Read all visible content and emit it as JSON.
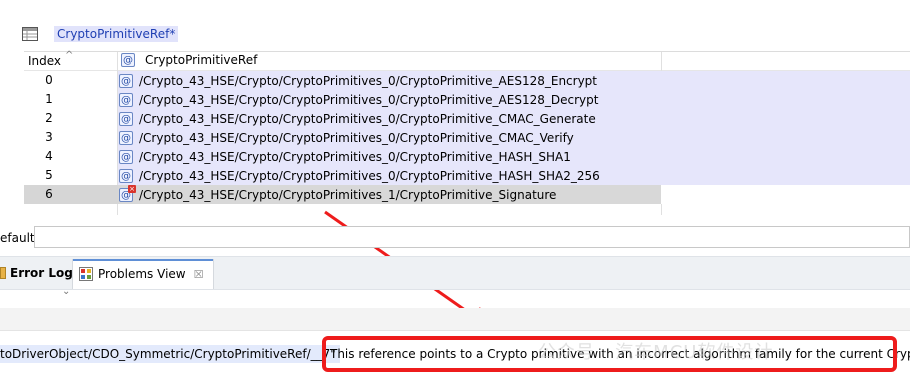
{
  "editor": {
    "title": "CryptoPrimitiveRef*",
    "table_icon": "table-icon"
  },
  "table": {
    "headers": {
      "index": "Index",
      "ref": "CryptoPrimitiveRef"
    },
    "ref_icon": "at-reference-icon",
    "rows": [
      {
        "index": "0",
        "path": "/Crypto_43_HSE/Crypto/CryptoPrimitives_0/CryptoPrimitive_AES128_Encrypt",
        "error": false
      },
      {
        "index": "1",
        "path": "/Crypto_43_HSE/Crypto/CryptoPrimitives_0/CryptoPrimitive_AES128_Decrypt",
        "error": false
      },
      {
        "index": "2",
        "path": "/Crypto_43_HSE/Crypto/CryptoPrimitives_0/CryptoPrimitive_CMAC_Generate",
        "error": false
      },
      {
        "index": "3",
        "path": "/Crypto_43_HSE/Crypto/CryptoPrimitives_0/CryptoPrimitive_CMAC_Verify",
        "error": false
      },
      {
        "index": "4",
        "path": "/Crypto_43_HSE/Crypto/CryptoPrimitives_0/CryptoPrimitive_HASH_SHA1",
        "error": false
      },
      {
        "index": "5",
        "path": "/Crypto_43_HSE/Crypto/CryptoPrimitives_0/CryptoPrimitive_HASH_SHA2_256",
        "error": false
      },
      {
        "index": "6",
        "path": "/Crypto_43_HSE/Crypto/CryptoPrimitives_1/CryptoPrimitive_Signature",
        "error": true
      }
    ]
  },
  "default_field": {
    "label": "efault",
    "value": ""
  },
  "tabs": {
    "error_log": "Error Log",
    "problems_view": "Problems View",
    "close_glyph": "☒"
  },
  "problem": {
    "path": "toDriverObject/CDO_Symmetric/CryptoPrimitiveRef/__7\"",
    "message": "This reference points to a Crypto primitive with an incorrect algorithm family for the current Cryp"
  },
  "watermark": "公众号 · 汽车MCU软件设计",
  "colors": {
    "highlight": "#ee1c1c",
    "selection": "#e6e6fb",
    "title_text": "#1f3fb3"
  }
}
